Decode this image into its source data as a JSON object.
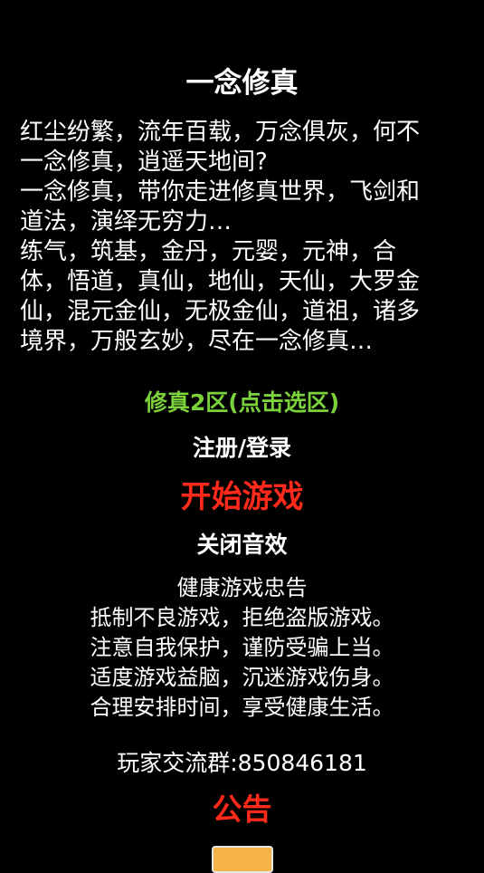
{
  "title": "一念修真",
  "intro": [
    "红尘纷繁，流年百载，万念俱灰，何不",
    "一念修真，逍遥天地间?",
    "一念修真，带你走进修真世界，飞剑和",
    "道法，演绎无穷力…",
    "练气，筑基，金丹，元婴，元神，合",
    "体，悟道，真仙，地仙，天仙，大罗金",
    "仙，混元金仙，无极金仙，道祖，诸多",
    "境界，万般玄妙，尽在一念修真…"
  ],
  "server_select": "修真2区(点击选区)",
  "login": "注册/登录",
  "start_game": "开始游戏",
  "toggle_sound": "关闭音效",
  "health_advice": {
    "heading": "健康游戏忠告",
    "lines": [
      "抵制不良游戏，拒绝盗版游戏。",
      "注意自我保护，谨防受骗上当。",
      "适度游戏益脑，沉迷游戏伤身。",
      "合理安排时间，享受健康生活。"
    ]
  },
  "player_group": "玩家交流群:850846181",
  "notice": "公告",
  "colors": {
    "background": "#000000",
    "text": "#ffffff",
    "server": "#7bd23a",
    "start": "#ff2a1a",
    "notice": "#ff2a1a",
    "button": "#f5b445"
  }
}
